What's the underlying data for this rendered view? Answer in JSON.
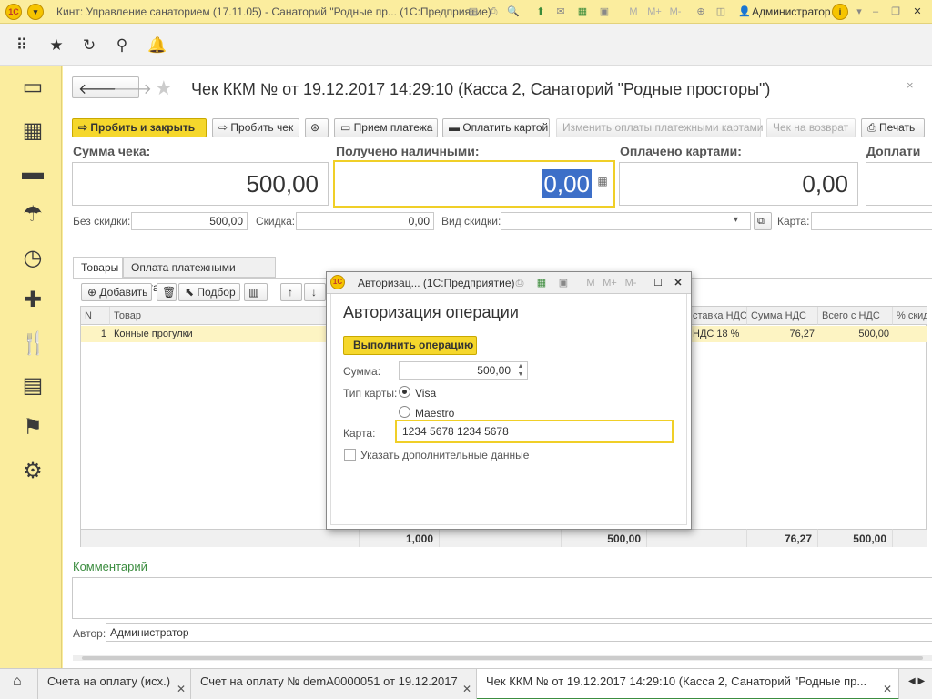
{
  "window": {
    "title": "Кинт: Управление санаторием (17.11.05) - Санаторий \"Родные пр... (1С:Предприятие)",
    "user": "Администратор",
    "memory_buttons": [
      "M",
      "M+",
      "M-"
    ]
  },
  "document": {
    "title": "Чек ККМ №  от 19.12.2017 14:29:10 (Касса 2, Санаторий \"Родные просторы\")"
  },
  "toolbar": {
    "punch_close": "Пробить и закрыть",
    "punch": "Пробить чек",
    "payment_receive": "Прием платежа",
    "pay_card": "Оплатить картой",
    "change_card_payments": "Изменить оплаты платежными картами",
    "return_check": "Чек на возврат",
    "print": "Печать"
  },
  "sums": {
    "check_sum_label": "Сумма чека:",
    "check_sum_value": "500,00",
    "cash_received_label": "Получено наличными:",
    "cash_received_value": "0,00",
    "paid_cards_label": "Оплачено картами:",
    "paid_cards_value": "0,00",
    "extra_label": "Доплати"
  },
  "discount": {
    "no_discount_label": "Без скидки:",
    "no_discount_value": "500,00",
    "discount_label": "Скидка:",
    "discount_value": "0,00",
    "discount_type_label": "Вид скидки:",
    "discount_type_value": "",
    "card_label": "Карта:",
    "card_value": ""
  },
  "tabs": {
    "goods": "Товары",
    "card_payments": "Оплата платежными картами"
  },
  "table_toolbar": {
    "add": "Добавить",
    "pick": "Подбор"
  },
  "table": {
    "columns": [
      "N",
      "Товар",
      "",
      "",
      "",
      "",
      "ставка НДС",
      "Сумма НДС",
      "Всего с НДС",
      "% скид"
    ],
    "rows": [
      {
        "n": "1",
        "product": "Конные прогулки",
        "vat_rate": "НДС 18 %",
        "vat_sum": "76,27",
        "total": "500,00",
        "disc": ""
      }
    ],
    "footer": {
      "qty": "1,000",
      "sum": "500,00",
      "vat": "76,27",
      "total": "500,00"
    }
  },
  "comment": {
    "label": "Комментарий",
    "value": ""
  },
  "author": {
    "label": "Автор:",
    "value": "Администратор"
  },
  "modal": {
    "header_title": "Авторизац... (1С:Предприятие)",
    "title": "Авторизация операции",
    "execute_button": "Выполнить операцию",
    "sum_label": "Сумма:",
    "sum_value": "500,00",
    "card_type_label": "Тип карты:",
    "card_types": [
      "Visa",
      "Maestro"
    ],
    "card_type_selected": "Visa",
    "card_label": "Карта:",
    "card_value": "1234 5678 1234 5678",
    "extra_data_label": "Указать дополнительные данные",
    "extra_data_checked": false
  },
  "bottom_tabs": [
    {
      "label": "Счета на оплату (исх.)"
    },
    {
      "label": "Счет на оплату № demA0000051 от 19.12.2017"
    },
    {
      "label": "Чек ККМ №  от 19.12.2017 14:29:10 (Касса 2, Санаторий \"Родные пр..."
    }
  ],
  "colors": {
    "accent": "#f5d72c",
    "sidebar": "#fbed9e",
    "link_green": "#3c8d40"
  }
}
